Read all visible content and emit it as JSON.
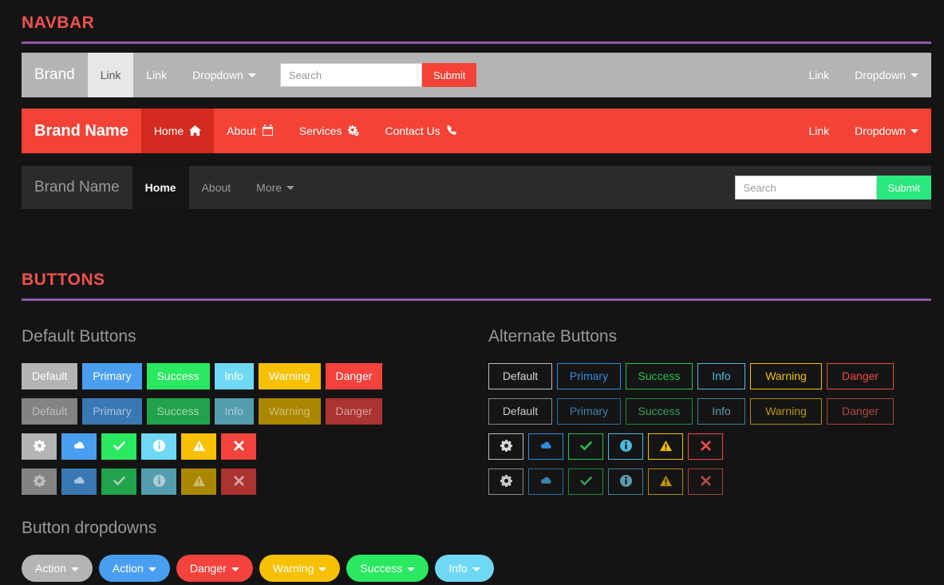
{
  "sections": {
    "navbar": {
      "title": "NAVBAR",
      "accent": "#ef5350",
      "rule_color": "#8e5ba6"
    },
    "buttons": {
      "title": "BUTTONS",
      "accent": "#ef5350",
      "rule_color": "#8e5ba6"
    }
  },
  "navbar_default": {
    "brand": "Brand",
    "links": [
      {
        "label": "Link",
        "active": true
      },
      {
        "label": "Link",
        "active": false
      },
      {
        "label": "Dropdown",
        "active": false,
        "caret": true
      }
    ],
    "search": {
      "placeholder": "Search",
      "value": ""
    },
    "submit_label": "Submit",
    "submit_color": "#f44336",
    "right_links": [
      {
        "label": "Link",
        "caret": false
      },
      {
        "label": "Dropdown",
        "caret": true
      }
    ],
    "background": "#b4b4b4"
  },
  "navbar_red": {
    "brand": "Brand Name",
    "links": [
      {
        "label": "Home",
        "active": true,
        "icon": "home-icon"
      },
      {
        "label": "About",
        "active": false,
        "icon": "calendar-icon"
      },
      {
        "label": "Services",
        "active": false,
        "icon": "gears-icon"
      },
      {
        "label": "Contact Us",
        "active": false,
        "icon": "phone-icon"
      }
    ],
    "right_links": [
      {
        "label": "Link",
        "caret": false
      },
      {
        "label": "Dropdown",
        "caret": true
      }
    ],
    "background": "#f44336"
  },
  "navbar_dark": {
    "brand": "Brand Name",
    "links": [
      {
        "label": "Home",
        "active": true
      },
      {
        "label": "About",
        "active": false
      },
      {
        "label": "More",
        "active": false,
        "caret": true
      }
    ],
    "search": {
      "placeholder": "Search",
      "value": ""
    },
    "submit_label": "Submit",
    "submit_color": "#2ae87d",
    "background": "#2b2b2b"
  },
  "buttons": {
    "default_heading": "Default Buttons",
    "alternate_heading": "Alternate Buttons",
    "dropdown_heading": "Button dropdowns",
    "labels": [
      "Default",
      "Primary",
      "Success",
      "Info",
      "Warning",
      "Danger"
    ],
    "icons": [
      "gear-icon",
      "cloud-icon",
      "check-icon",
      "info-circle-icon",
      "warning-triangle-icon",
      "times-icon"
    ],
    "solid_colors": {
      "default": "#b4b4b4",
      "primary": "#4a9ef0",
      "success": "#2ae860",
      "info": "#6fd9f5",
      "warning": "#f7c000",
      "danger": "#f4433c"
    },
    "outline_colors": {
      "default": "#bdbdbd",
      "primary": "#2f8de0",
      "success": "#22c24e",
      "info": "#4ebce0",
      "warning": "#f2c000",
      "danger": "#ef4b44"
    },
    "dropdowns": [
      {
        "label": "Action",
        "variant": "default"
      },
      {
        "label": "Action",
        "variant": "primary"
      },
      {
        "label": "Danger",
        "variant": "danger"
      },
      {
        "label": "Warning",
        "variant": "warning"
      },
      {
        "label": "Success",
        "variant": "success"
      },
      {
        "label": "Info",
        "variant": "info"
      }
    ]
  }
}
